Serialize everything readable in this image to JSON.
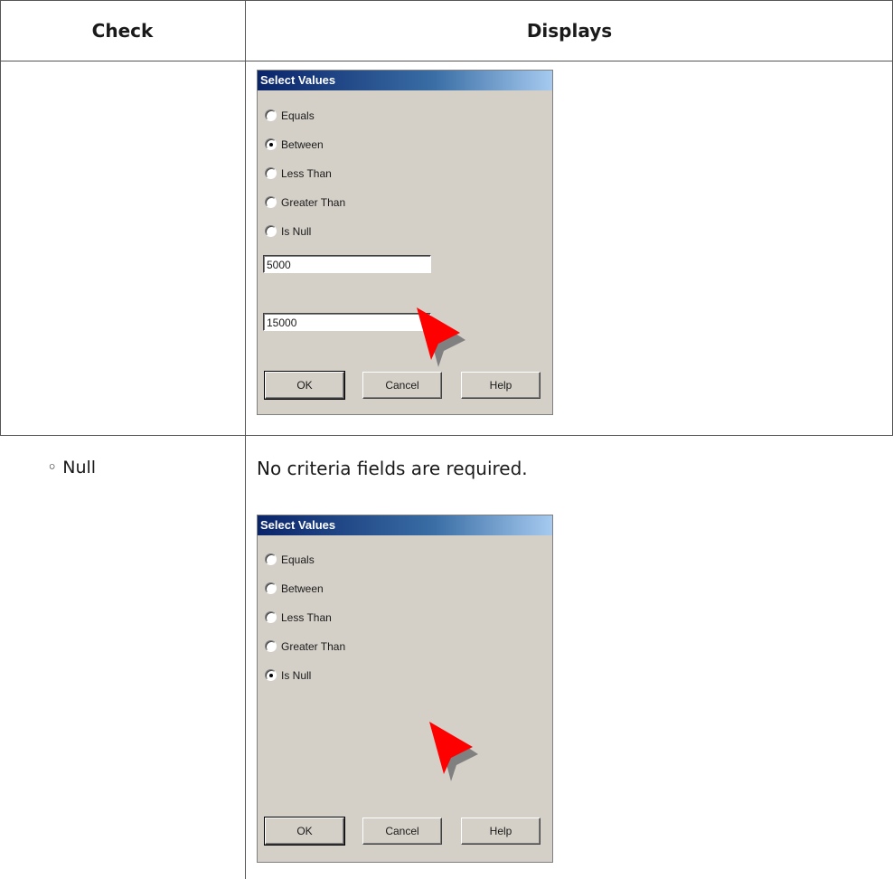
{
  "table": {
    "headers": {
      "check": "Check",
      "displays": "Displays"
    },
    "rows": [
      {
        "check": "",
        "description": "",
        "dialog": {
          "title": "Select Values",
          "options": [
            "Equals",
            "Between",
            "Less Than",
            "Greater Than",
            "Is Null"
          ],
          "selected": "Between",
          "field1_value": "5000",
          "field2_value": "15000",
          "buttons": {
            "ok": "OK",
            "cancel": "Cancel",
            "help": "Help"
          }
        }
      },
      {
        "check": "◦ Null",
        "description": "No criteria fields are required.",
        "dialog": {
          "title": "Select Values",
          "options": [
            "Equals",
            "Between",
            "Less Than",
            "Greater Than",
            "Is Null"
          ],
          "selected": "Is Null",
          "buttons": {
            "ok": "OK",
            "cancel": "Cancel",
            "help": "Help"
          }
        }
      }
    ]
  },
  "icons": {
    "pointer": "red-arrow-pointer-icon"
  },
  "colors": {
    "pointer": "#ff0000",
    "dialog_bg": "#d4d0c8",
    "titlebar": "#0a246a"
  }
}
